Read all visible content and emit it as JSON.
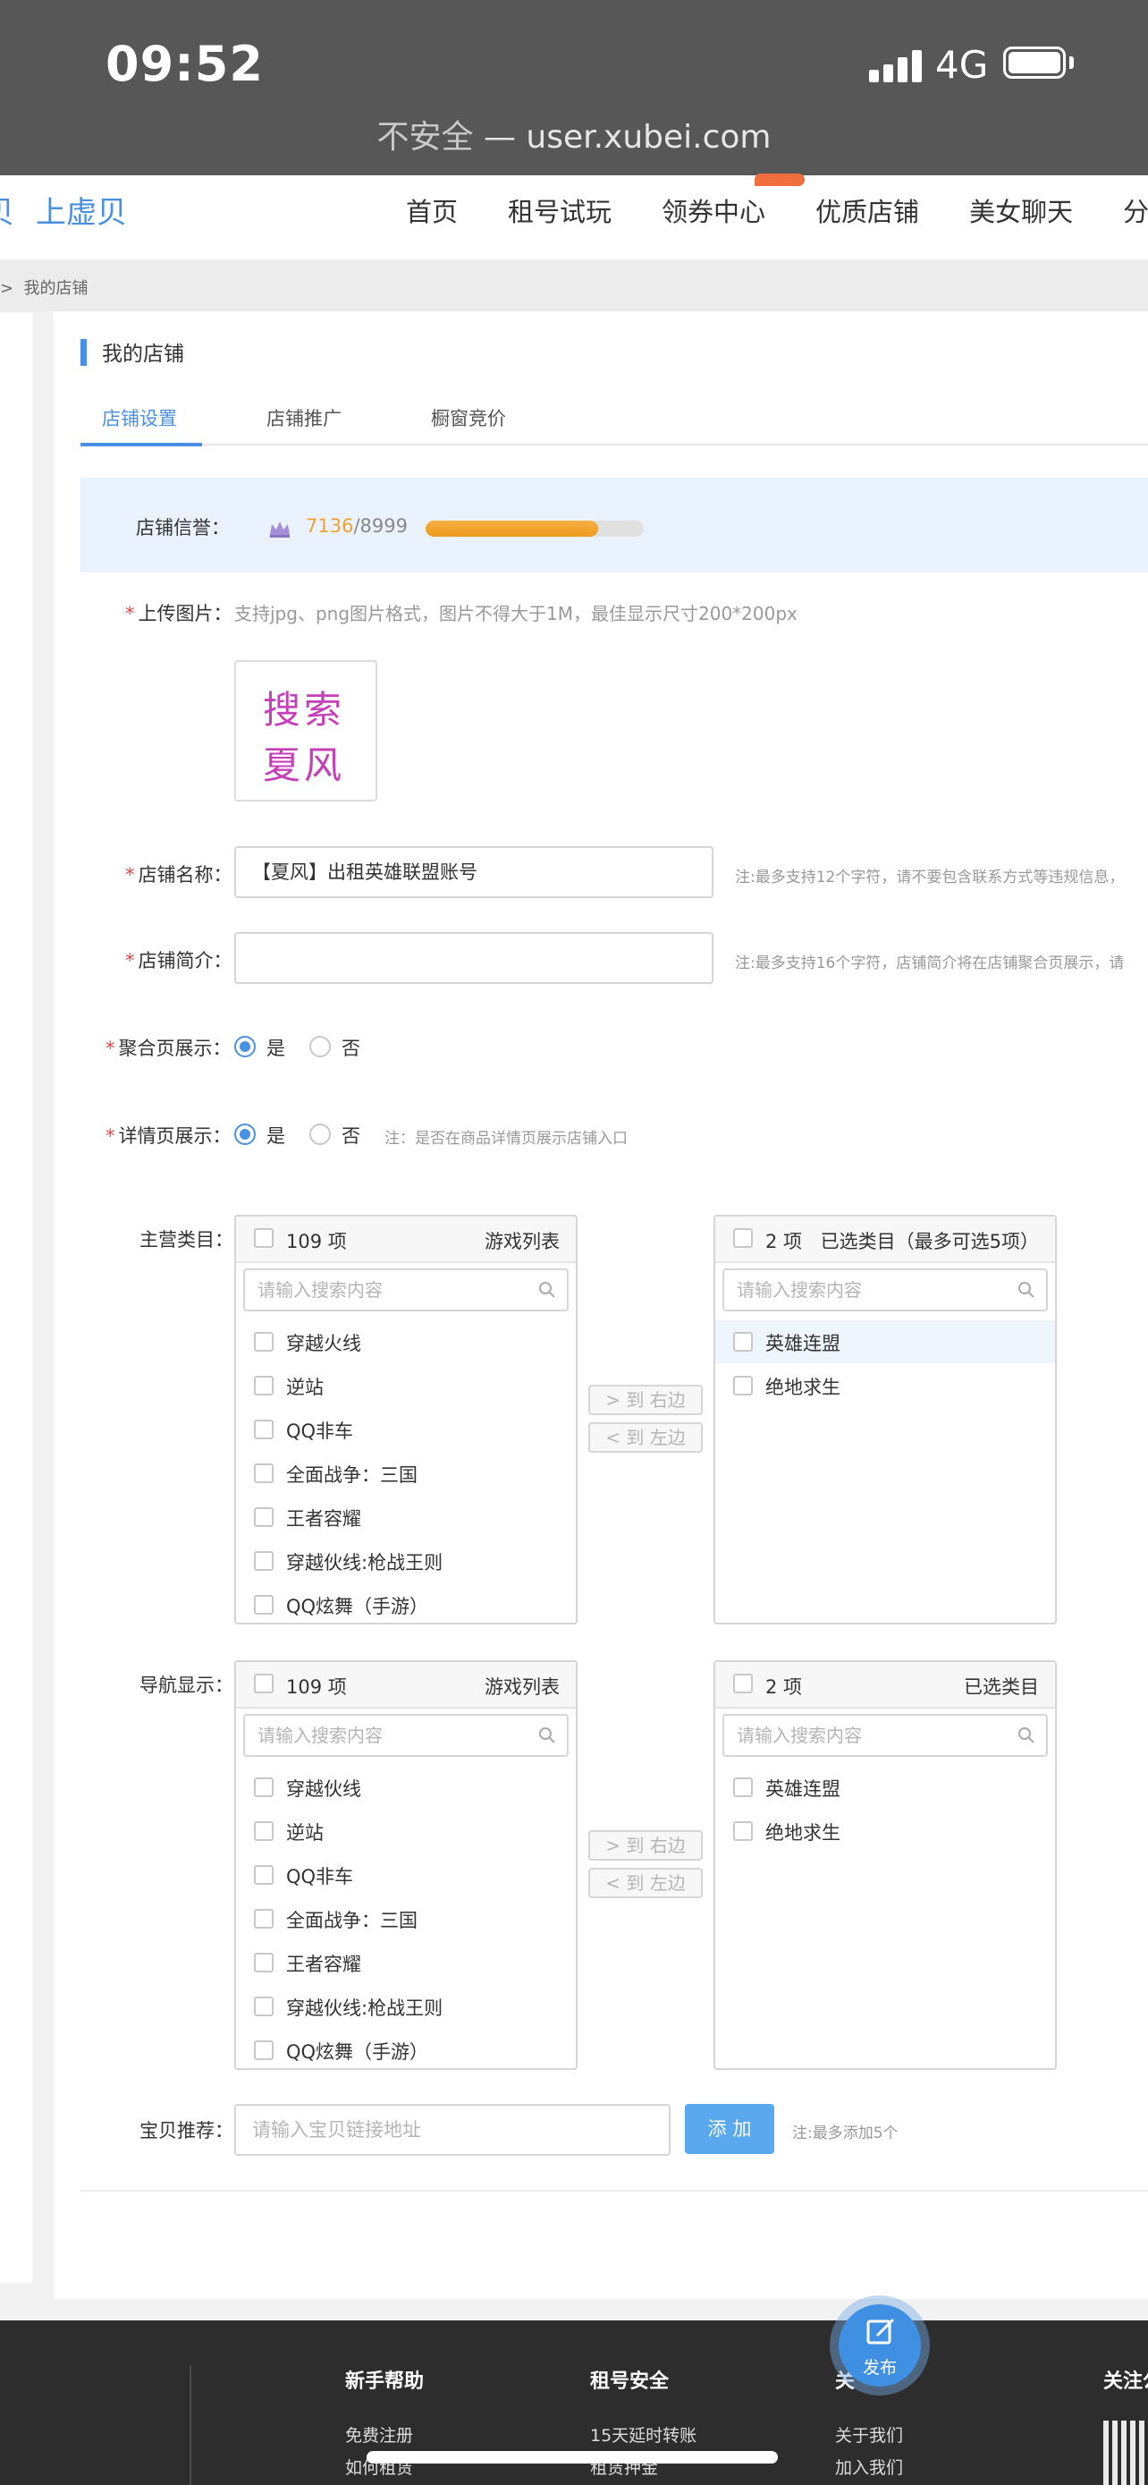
{
  "status_bar": {
    "time": "09:52",
    "network": "4G"
  },
  "address_bar": {
    "insecure_label": "不安全",
    "separator": " — ",
    "domain": "user.xubei.com"
  },
  "header": {
    "logo_partial": "贝",
    "logo_name": "上虚贝",
    "nav": [
      "首页",
      "租号试玩",
      "领券中心",
      "优质店铺",
      "美女聊天",
      "分站"
    ]
  },
  "breadcrumb": {
    "arrow": ">",
    "current": "我的店铺"
  },
  "section_title": "我的店铺",
  "tabs": [
    "店铺设置",
    "店铺推广",
    "橱窗竞价"
  ],
  "credit": {
    "label": "店铺信誉：",
    "current": "7136",
    "separator": "/",
    "max": "8999",
    "progress_fraction": 0.793
  },
  "form": {
    "upload": {
      "label": "上传图片：",
      "hint": "支持jpg、png图片格式，图片不得大于1M，最佳显示尺寸200*200px",
      "preview_line1": "搜索",
      "preview_line2": "夏风"
    },
    "shop_name": {
      "label": "店铺名称：",
      "value": "【夏风】出租英雄联盟账号",
      "hint": "注:最多支持12个字符，请不要包含联系方式等违规信息，"
    },
    "shop_intro": {
      "label": "店铺简介：",
      "value": "",
      "hint": "注:最多支持16个字符，店铺简介将在店铺聚合页展示，请"
    },
    "aggregate_display": {
      "label": "聚合页展示：",
      "yes": "是",
      "no": "否",
      "selected": "是"
    },
    "detail_display": {
      "label": "详情页展示：",
      "yes": "是",
      "no": "否",
      "selected": "是",
      "hint": "注：是否在商品详情页展示店铺入口"
    },
    "main_category": {
      "label": "主营类目：",
      "left": {
        "count": "109 项",
        "title": "游戏列表",
        "search_placeholder": "请输入搜索内容",
        "items": [
          "穿越火线",
          "逆站",
          "QQ非车",
          "全面战争：三国",
          "王者容耀",
          "穿越伙线:枪战王则",
          "QQ炫舞（手游）"
        ]
      },
      "right": {
        "count": "2 项",
        "title": "已选类目（最多可选5项）",
        "search_placeholder": "请输入搜索内容",
        "items": [
          "英雄连盟",
          "绝地求生"
        ]
      },
      "to_right": "> 到 右边",
      "to_left": "< 到 左边"
    },
    "nav_display": {
      "label": "导航显示：",
      "left": {
        "count": "109 项",
        "title": "游戏列表",
        "search_placeholder": "请输入搜索内容",
        "items": [
          "穿越伙线",
          "逆站",
          "QQ非车",
          "全面战争：三国",
          "王者容耀",
          "穿越伙线:枪战王则",
          "QQ炫舞（手游）"
        ]
      },
      "right": {
        "count": "2 项",
        "title": "已选类目",
        "search_placeholder": "请输入搜索内容",
        "items": [
          "英雄连盟",
          "绝地求生"
        ]
      },
      "to_right": "> 到 右边",
      "to_left": "< 到 左边"
    },
    "recommend": {
      "label": "宝贝推荐：",
      "placeholder": "请输入宝贝链接地址",
      "add_button": "添 加",
      "hint": "注:最多添加5个"
    }
  },
  "footer": {
    "col1": {
      "title": "新手帮助",
      "links": [
        "免费注册",
        "如何租赁"
      ]
    },
    "col2": {
      "title": "租号安全",
      "links": [
        "15天延时转账",
        "租赁押金"
      ]
    },
    "col3": {
      "title": "关",
      "links": [
        "关于我们",
        "加入我们"
      ]
    },
    "col4": {
      "title": "关注公"
    }
  },
  "fab": {
    "label": "发布"
  },
  "colors": {
    "accent": "#4a90e2",
    "required": "#e64545",
    "progress": "#f0a030",
    "footer_bg": "#2d2d2d"
  }
}
